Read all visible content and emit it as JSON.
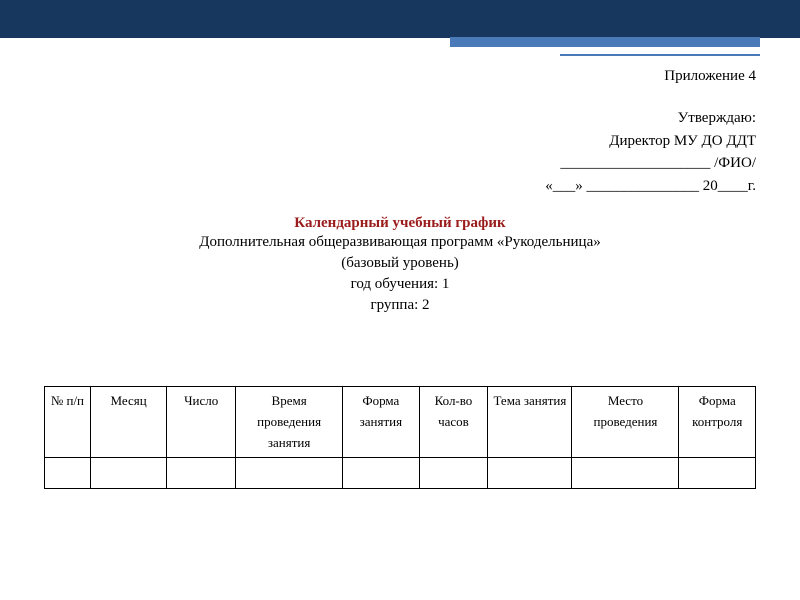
{
  "appendix": "Приложение 4",
  "approve": {
    "line1": "Утверждаю:",
    "line2": "Директор МУ ДО ДДТ",
    "line3": "____________________ /ФИО/",
    "line4": "«___»  _______________ 20____г."
  },
  "title": "Календарный учебный график",
  "subtitle": {
    "program": "Дополнительная общеразвивающая программ «Рукодельница»",
    "level": "(базовый уровень)",
    "year": "год обучения: 1",
    "group": "группа: 2"
  },
  "table": {
    "headers": [
      "№ п/п",
      "Месяц",
      "Число",
      "Время проведения занятия",
      "Форма занятия",
      "Кол-во часов",
      "Тема занятия",
      "Место проведения",
      "Форма контроля"
    ],
    "rows": [
      [
        "",
        "",
        "",
        "",
        "",
        "",
        "",
        "",
        ""
      ]
    ],
    "col_widths_pct": [
      6,
      10,
      9,
      14,
      10,
      9,
      11,
      14,
      10
    ]
  }
}
